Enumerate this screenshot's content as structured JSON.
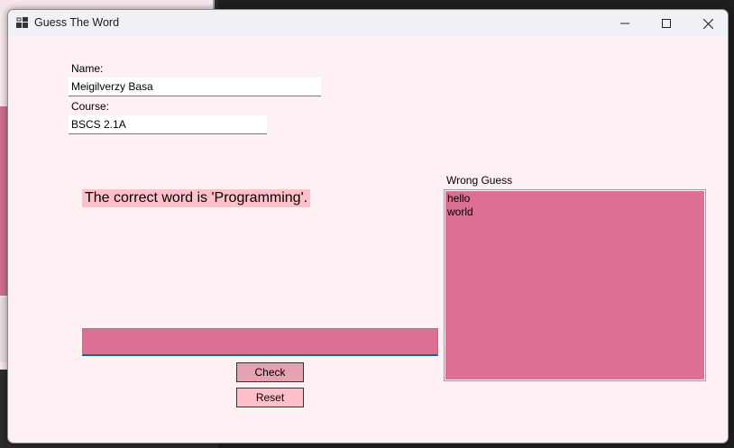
{
  "window": {
    "title": "Guess The Word",
    "controls": [
      "minimize",
      "maximize",
      "close"
    ],
    "icon": "app-window-icon"
  },
  "form": {
    "name_label": "Name:",
    "name_value": "Meigilverzy Basa",
    "course_label": "Course:",
    "course_value": "BSCS 2.1A"
  },
  "game": {
    "message": "The correct word is 'Programming'.",
    "guess_value": "",
    "wrong_guess_label": "Wrong Guess",
    "wrong_guesses": [
      "hello",
      "world"
    ],
    "check_label": "Check",
    "reset_label": "Reset"
  },
  "colors": {
    "window_bg": "#fff0f4",
    "input_bg": "#db7093",
    "message_bg": "#ffc0cb",
    "check_bg": "#e5a2b0",
    "reset_bg": "#ffc0cb",
    "focus_underline": "#0067c0"
  }
}
